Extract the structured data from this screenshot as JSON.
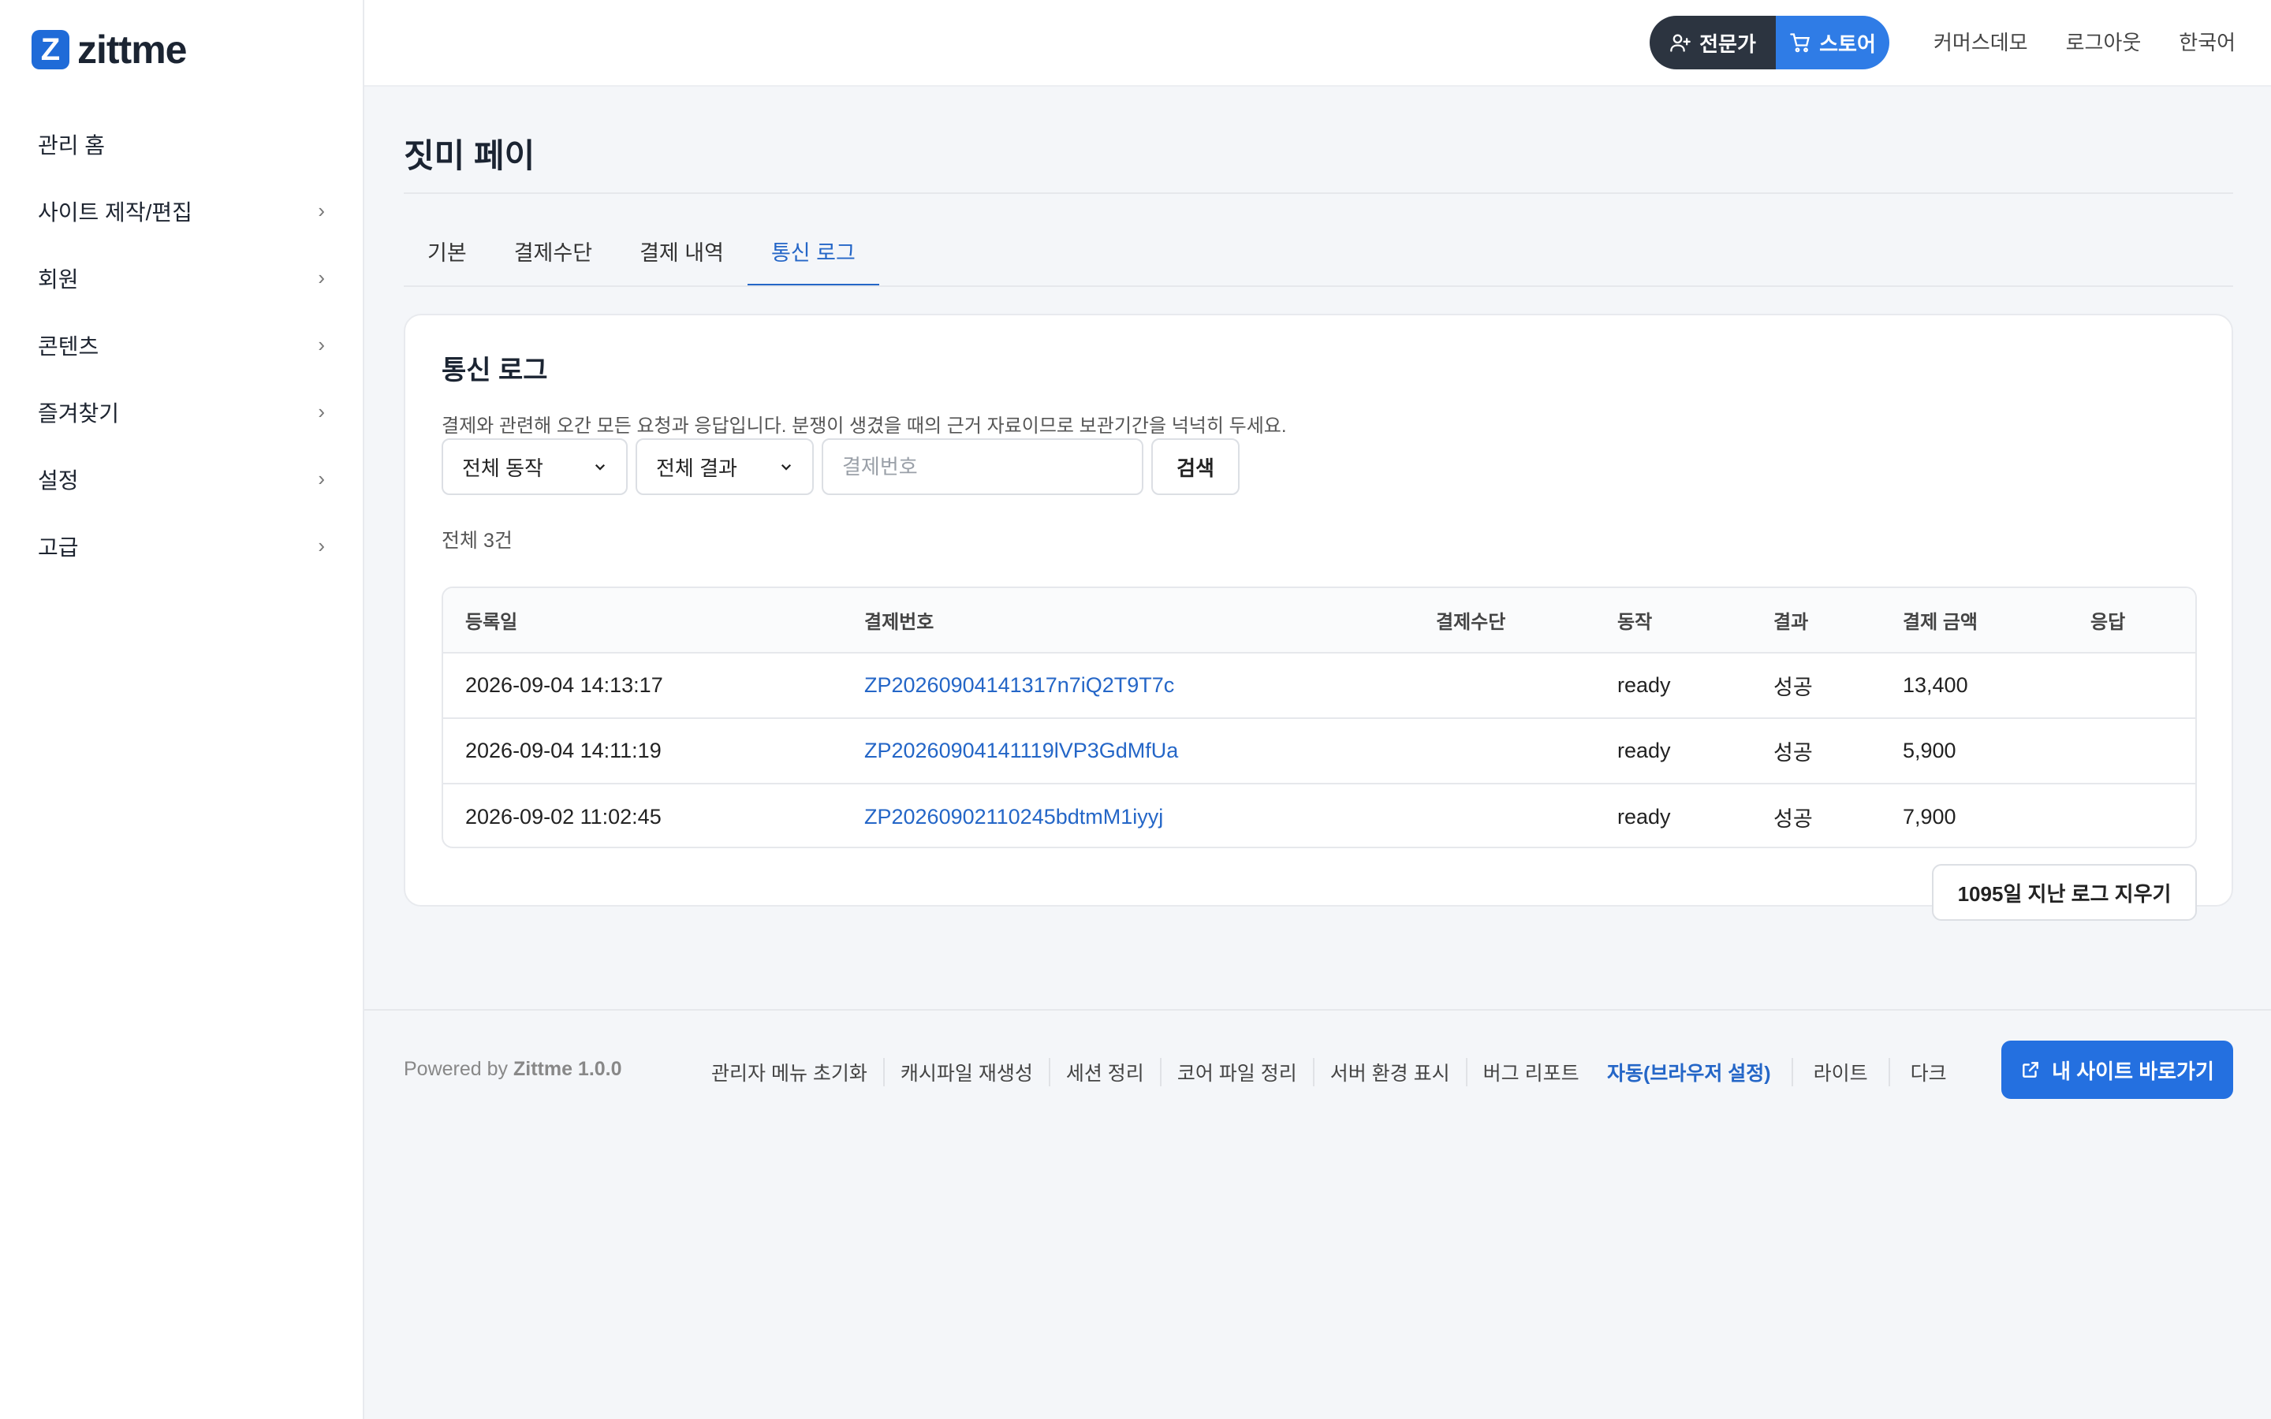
{
  "brand": {
    "name": "zittme",
    "logo_letter": "Z"
  },
  "sidebar": {
    "items": [
      {
        "label": "관리 홈",
        "has_chevron": false
      },
      {
        "label": "사이트 제작/편집",
        "has_chevron": true
      },
      {
        "label": "회원",
        "has_chevron": true
      },
      {
        "label": "콘텐츠",
        "has_chevron": true
      },
      {
        "label": "즐겨찾기",
        "has_chevron": true
      },
      {
        "label": "설정",
        "has_chevron": true
      },
      {
        "label": "고급",
        "has_chevron": true
      }
    ],
    "chevron": "›"
  },
  "topbar": {
    "expert_label": "전문가",
    "store_label": "스토어",
    "links": [
      "커머스데모",
      "로그아웃",
      "한국어"
    ]
  },
  "page": {
    "title": "짓미 페이",
    "tabs": [
      {
        "label": "기본",
        "active": false
      },
      {
        "label": "결제수단",
        "active": false
      },
      {
        "label": "결제 내역",
        "active": false
      },
      {
        "label": "통신 로그",
        "active": true
      }
    ]
  },
  "log": {
    "title": "통신 로그",
    "description": "결제와 관련해 오간 모든 요청과 응답입니다. 분쟁이 생겼을 때의 근거 자료이므로 보관기간을 넉넉히 두세요.",
    "filter_action": "전체 동작",
    "filter_result": "전체 결과",
    "search_placeholder": "결제번호",
    "search_button": "검색",
    "total_text": "전체 3건",
    "columns": [
      "등록일",
      "결제번호",
      "결제수단",
      "동작",
      "결과",
      "결제 금액",
      "응답"
    ],
    "rows": [
      {
        "date": "2026-09-04 14:13:17",
        "payment_id": "ZP20260904141317n7iQ2T9T7c",
        "method": "",
        "action": "ready",
        "result": "성공",
        "amount": "13,400",
        "response": ""
      },
      {
        "date": "2026-09-04 14:11:19",
        "payment_id": "ZP20260904141119lVP3GdMfUa",
        "method": "",
        "action": "ready",
        "result": "성공",
        "amount": "5,900",
        "response": ""
      },
      {
        "date": "2026-09-02 11:02:45",
        "payment_id": "ZP20260902110245bdtmM1iyyj",
        "method": "",
        "action": "ready",
        "result": "성공",
        "amount": "7,900",
        "response": ""
      }
    ],
    "clear_button": "1095일 지난 로그 지우기"
  },
  "footer": {
    "powered_prefix": "Powered by",
    "powered_brand": "Zittme 1.0.0",
    "links": [
      "관리자 메뉴 초기화",
      "캐시파일 재생성",
      "세션 정리",
      "코어 파일 정리",
      "서버 환경 표시",
      "버그 리포트"
    ],
    "theme_options": [
      {
        "label": "자동(브라우저 설정)",
        "active": true
      },
      {
        "label": "라이트",
        "active": false
      },
      {
        "label": "다크",
        "active": false
      }
    ],
    "visit_button": "내 사이트 바로가기"
  },
  "colors": {
    "accent": "#2466c7",
    "primary_button": "#2470e0",
    "pill_dark": "#2c3440",
    "pill_blue": "#2f7ce6"
  }
}
